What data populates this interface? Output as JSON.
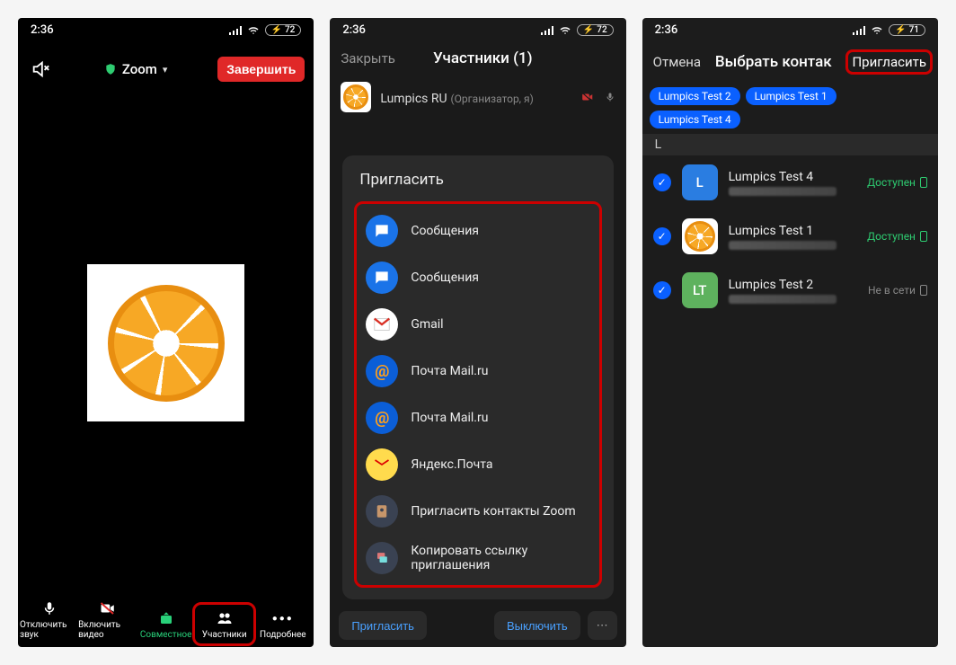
{
  "statusbar": {
    "time": "2:36",
    "battery1": "72",
    "battery3": "71"
  },
  "screen1": {
    "title": "Zoom",
    "end": "Завершить",
    "bottom": {
      "mute": "Отключить звук",
      "video": "Включить видео",
      "share": "Совместное",
      "participants": "Участники",
      "more": "Подробнее"
    }
  },
  "screen2": {
    "close": "Закрыть",
    "title": "Участники (1)",
    "participant": {
      "name": "Lumpics RU",
      "role": "(Организатор, я)"
    },
    "sheet_title": "Пригласить",
    "items": [
      {
        "label": "Сообщения",
        "icon": "messages-blue"
      },
      {
        "label": "Сообщения",
        "icon": "messages-blue"
      },
      {
        "label": "Gmail",
        "icon": "gmail"
      },
      {
        "label": "Почта Mail.ru",
        "icon": "mailru"
      },
      {
        "label": "Почта Mail.ru",
        "icon": "mailru"
      },
      {
        "label": "Яндекс.Почта",
        "icon": "yandex"
      },
      {
        "label": "Пригласить контакты Zoom",
        "icon": "zoom"
      },
      {
        "label": "Копировать ссылку приглашения",
        "icon": "copy"
      }
    ],
    "invite_btn": "Пригласить",
    "off_btn": "Выключить"
  },
  "screen3": {
    "cancel": "Отмена",
    "title": "Выбрать контак",
    "invite": "Пригласить",
    "chips": [
      "Lumpics Test 2",
      "Lumpics Test 1",
      "Lumpics  Test 4"
    ],
    "section": "L",
    "contacts": [
      {
        "name": "Lumpics  Test 4",
        "initials": "L",
        "avatar": "blue",
        "status": "Доступен",
        "online": true
      },
      {
        "name": "Lumpics Test 1",
        "initials": "",
        "avatar": "img",
        "status": "Доступен",
        "online": true
      },
      {
        "name": "Lumpics Test 2",
        "initials": "LT",
        "avatar": "green",
        "status": "Не в сети",
        "online": false
      }
    ]
  }
}
